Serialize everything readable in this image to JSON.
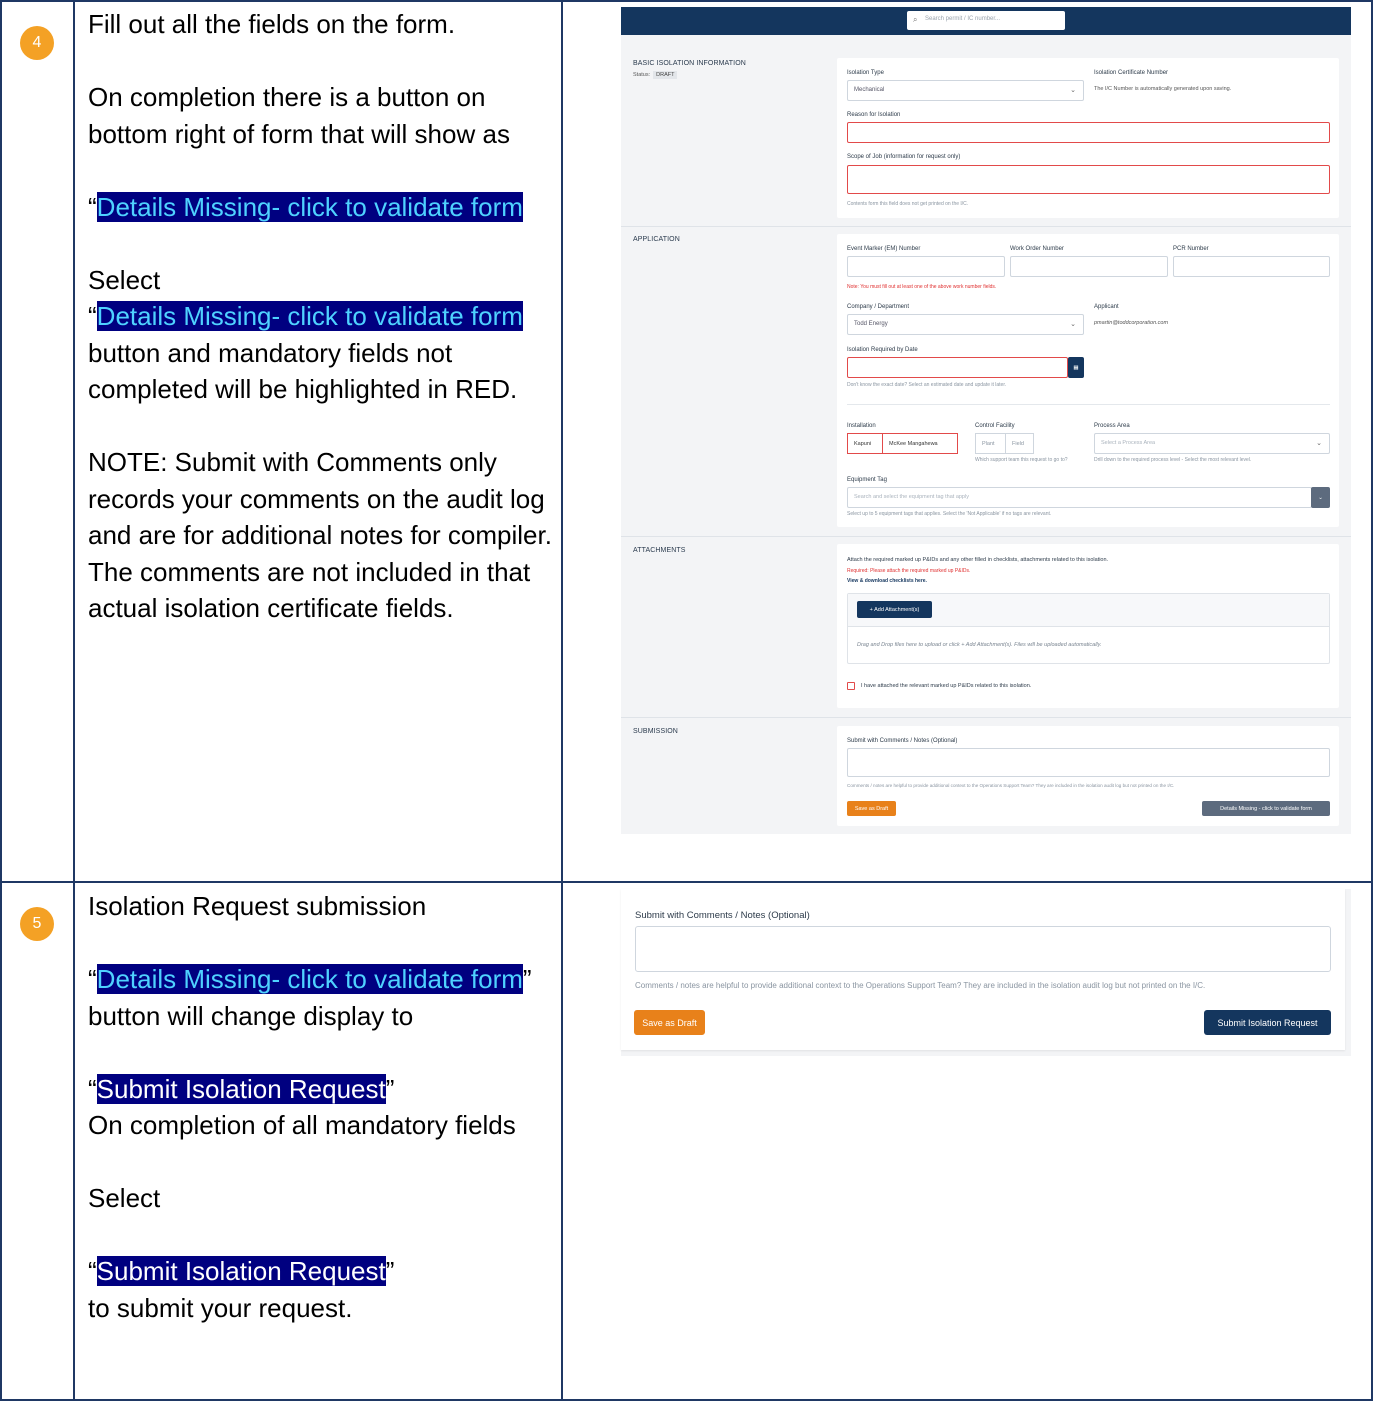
{
  "steps": [
    {
      "number": "4",
      "line1": "Fill out all the fields on the form.",
      "line2": "On completion there is a button on bottom right of form that will show as",
      "quote_open": "“",
      "highlight1": "Details Missing- click to validate form",
      "select": "Select",
      "highlight2": "Details Missing- click to validate form",
      "line3": "button and mandatory fields not completed will be highlighted in RED.",
      "note1": "NOTE: Submit with Comments only records your comments on the audit log and are for additional notes for compiler.",
      "note2": "The comments are not included in that actual isolation certificate fields."
    },
    {
      "number": "5",
      "line1": "Isolation Request submission",
      "quote_open": "“",
      "quote_close": "”",
      "highlight1": "Details Missing- click to validate form",
      "after1": " button will change display to",
      "highlight2": "Submit Isolation Request",
      "line2": "On completion of all mandatory fields",
      "select": "Select",
      "highlight3": "Submit Isolation Request",
      "line3": "to submit your request."
    }
  ],
  "form": {
    "search_placeholder": "Search permit / IC number...",
    "basic": {
      "title": "BASIC ISOLATION INFORMATION",
      "status_label": "Status:",
      "status_value": "DRAFT",
      "isolation_type_label": "Isolation Type",
      "isolation_type_value": "Mechanical",
      "ic_number_label": "Isolation Certificate Number",
      "ic_number_hint": "The I/C Number is automatically generated upon saving.",
      "reason_label": "Reason for Isolation",
      "scope_label": "Scope of Job (information for request only)",
      "scope_hint": "Contents form this field does not get printed on the I/C."
    },
    "application": {
      "title": "APPLICATION",
      "em_label": "Event Marker (EM) Number",
      "wo_label": "Work Order Number",
      "pcr_label": "PCR Number",
      "work_note": "Note: You must fill out at least one of the above work number fields.",
      "company_label": "Company / Department",
      "company_value": "Todd Energy",
      "applicant_label": "Applicant",
      "applicant_value": "pmartin@toddcorporation.com",
      "date_label": "Isolation Required by Date",
      "date_hint": "Don't know the exact date? Select an estimated date and update it later.",
      "installation_label": "Installation",
      "installation_options": [
        "Kapuni",
        "McKee Mangahewa"
      ],
      "control_label": "Control Facility",
      "control_options": [
        "Plant",
        "Field"
      ],
      "control_hint": "Which support team this request to go to?",
      "process_label": "Process Area",
      "process_placeholder": "Select a Process Area",
      "process_hint": "Drill down to the required process level - Select the most relevant level.",
      "equipment_label": "Equipment Tag",
      "equipment_placeholder": "Search and select the equipment tag that apply",
      "equipment_hint": "Select up to 5 equipment tags that applies. Select the 'Not Applicable' if no tags are relevant."
    },
    "attachments": {
      "title": "ATTACHMENTS",
      "intro": "Attach the required marked up P&IDs and any other filled in checklists, attachments related to this isolation.",
      "required": "Required: Please attach the required marked up P&IDs.",
      "view_link": "View & download checklists here.",
      "add_button": "+ Add Attachment(s)",
      "drop_hint": "Drag and Drop files here to upload or click + Add Attachment(s). Files will be uploaded automatically.",
      "checkbox_label": "I have attached the relevant marked up P&IDs related to this isolation."
    },
    "submission": {
      "title": "SUBMISSION",
      "comments_label": "Submit with Comments / Notes (Optional)",
      "comments_hint": "Comments / notes are helpful to provide additional context to the Operations Support Team? They are included in the isolation audit log but not printed on the I/C.",
      "save_draft": "Save as Draft",
      "details_missing": "Details Missing - click to validate form"
    }
  },
  "form2": {
    "comments_label": "Submit with Comments / Notes (Optional)",
    "comments_hint": "Comments / notes are helpful to provide additional context to the Operations Support Team? They are included in the isolation audit log but not printed on the I/C.",
    "save_draft": "Save as Draft",
    "submit": "Submit Isolation Request"
  },
  "colors": {
    "border": "#1f3864",
    "badge": "#f4a125",
    "navy": "#14365e",
    "orange": "#e8811a",
    "highlight_bg": "#000080"
  }
}
